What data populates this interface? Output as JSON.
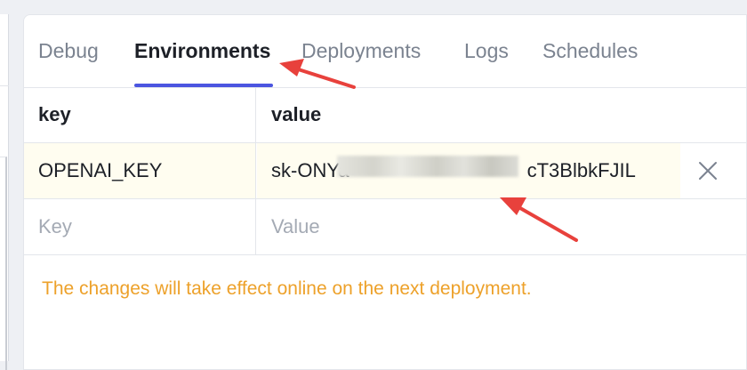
{
  "tabs": [
    {
      "label": "Debug"
    },
    {
      "label": "Environments"
    },
    {
      "label": "Deployments"
    },
    {
      "label": "Logs"
    },
    {
      "label": "Schedules"
    }
  ],
  "table": {
    "headers": {
      "key": "key",
      "value": "value"
    },
    "rows": [
      {
        "key": "OPENAI_KEY",
        "value": "sk-ONYa",
        "value_end": "cT3BlbkFJIL"
      }
    ],
    "new_row": {
      "key_placeholder": "Key",
      "value_placeholder": "Value"
    }
  },
  "notice": "The changes will take effect online on the next deployment.",
  "colors": {
    "accent": "#4b55e0",
    "warning": "#eda12a",
    "annotation": "#e8413c"
  },
  "icons": {
    "remove": "close-icon"
  }
}
